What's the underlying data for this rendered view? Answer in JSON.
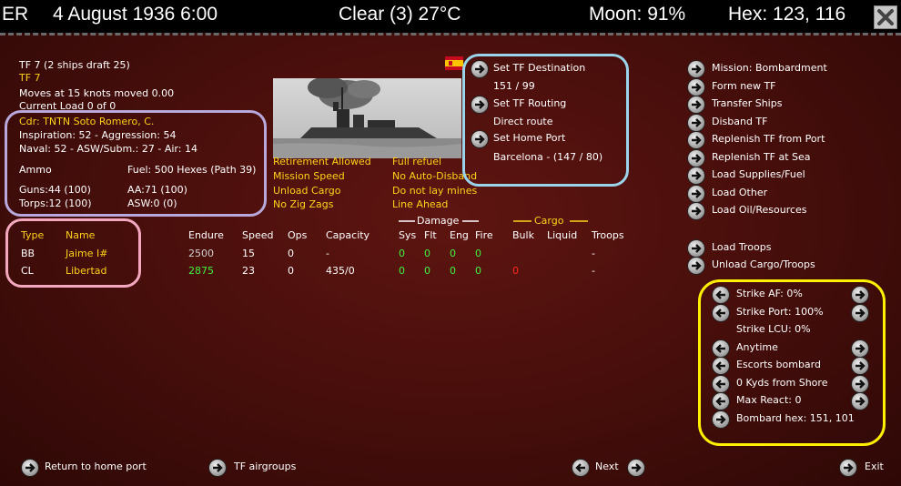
{
  "topbar": {
    "side": "ER",
    "date": "4 August 1936 6:00",
    "weather": "Clear (3) 27°C",
    "moon": "Moon: 91%",
    "hex": "Hex: 123, 116"
  },
  "tf": {
    "header": "TF 7 (2 ships draft 25)",
    "name": "TF 7",
    "moves": "Moves at 15 knots moved 0.00",
    "load": "Current Load 0 of 0"
  },
  "commander": {
    "name": "Cdr: TNTN Soto Romero, C.",
    "line1": "Inspiration: 52 - Aggression: 54",
    "line2": "Naval: 52 - ASW/Subm.: 27 - Air: 14"
  },
  "supplies": {
    "ammo": "Ammo",
    "fuel": "Fuel: 500 Hexes (Path 39)",
    "guns": "Guns:44 (100)",
    "aa": "AA:71 (100)",
    "torps": "Torps:12 (100)",
    "asw": "ASW:0 (0)"
  },
  "options": {
    "retirement": "Retirement Allowed",
    "speed": "Mission Speed",
    "unload": "Unload Cargo",
    "zigzag": "No Zig Zags",
    "refuel": "Full refuel",
    "disband": "No Auto-Disband",
    "mines": "Do not lay mines",
    "line": "Line Ahead"
  },
  "destination": {
    "set_dest": "Set TF Destination",
    "dest_value": "151 / 99",
    "set_routing": "Set TF Routing",
    "routing_value": "Direct route",
    "set_home": "Set Home Port",
    "home_value": "Barcelona - (147 / 80)"
  },
  "actions": [
    "Mission: Bombardment",
    "Form new TF",
    "Transfer Ships",
    "Disband TF",
    "Replenish TF from Port",
    "Replenish TF at Sea",
    "Load Supplies/Fuel",
    "Load Other",
    "Load Oil/Resources"
  ],
  "troops": {
    "load": "Load Troops",
    "unload": "Unload Cargo/Troops"
  },
  "bombard": {
    "strike_af": "Strike AF: 0%",
    "strike_port": "Strike Port: 100%",
    "strike_lcu": "Strike LCU: 0%",
    "time": "Anytime",
    "escorts": "Escorts bombard",
    "distance": "0 Kyds from Shore",
    "max_react": "Max React: 0",
    "hex": "Bombard hex: 151, 101"
  },
  "table": {
    "group_damage": "Damage",
    "group_cargo": "Cargo",
    "headers": {
      "type": "Type",
      "name": "Name",
      "endure": "Endure",
      "speed": "Speed",
      "ops": "Ops",
      "capacity": "Capacity",
      "sys": "Sys",
      "flt": "Flt",
      "eng": "Eng",
      "fire": "Fire",
      "bulk": "Bulk",
      "liquid": "Liquid",
      "troops": "Troops"
    },
    "rows": [
      {
        "type": "BB",
        "name": "Jaime I#",
        "endure": "2500",
        "speed": "15",
        "ops": "0",
        "capacity": "-",
        "sys": "0",
        "flt": "0",
        "eng": "0",
        "fire": "0",
        "bulk": "",
        "liquid": "",
        "troops": "-"
      },
      {
        "type": "CL",
        "name": "Libertad",
        "endure": "2875",
        "speed": "23",
        "ops": "0",
        "capacity": "435/0",
        "sys": "0",
        "flt": "0",
        "eng": "0",
        "fire": "0",
        "bulk": "0",
        "liquid": "",
        "troops": "-"
      }
    ]
  },
  "bottom": {
    "return": "Return to home port",
    "airgroups": "TF airgroups",
    "next": "Next",
    "exit": "Exit"
  },
  "colors": {
    "yellow": "#ffd21a",
    "green": "#3ef23e",
    "red": "#ff2a1a",
    "ring_lavender": "#b8a8dc",
    "ring_blue": "#9ad4ea",
    "ring_pink": "#f4a8c0",
    "ring_yellow": "#ffef00"
  }
}
